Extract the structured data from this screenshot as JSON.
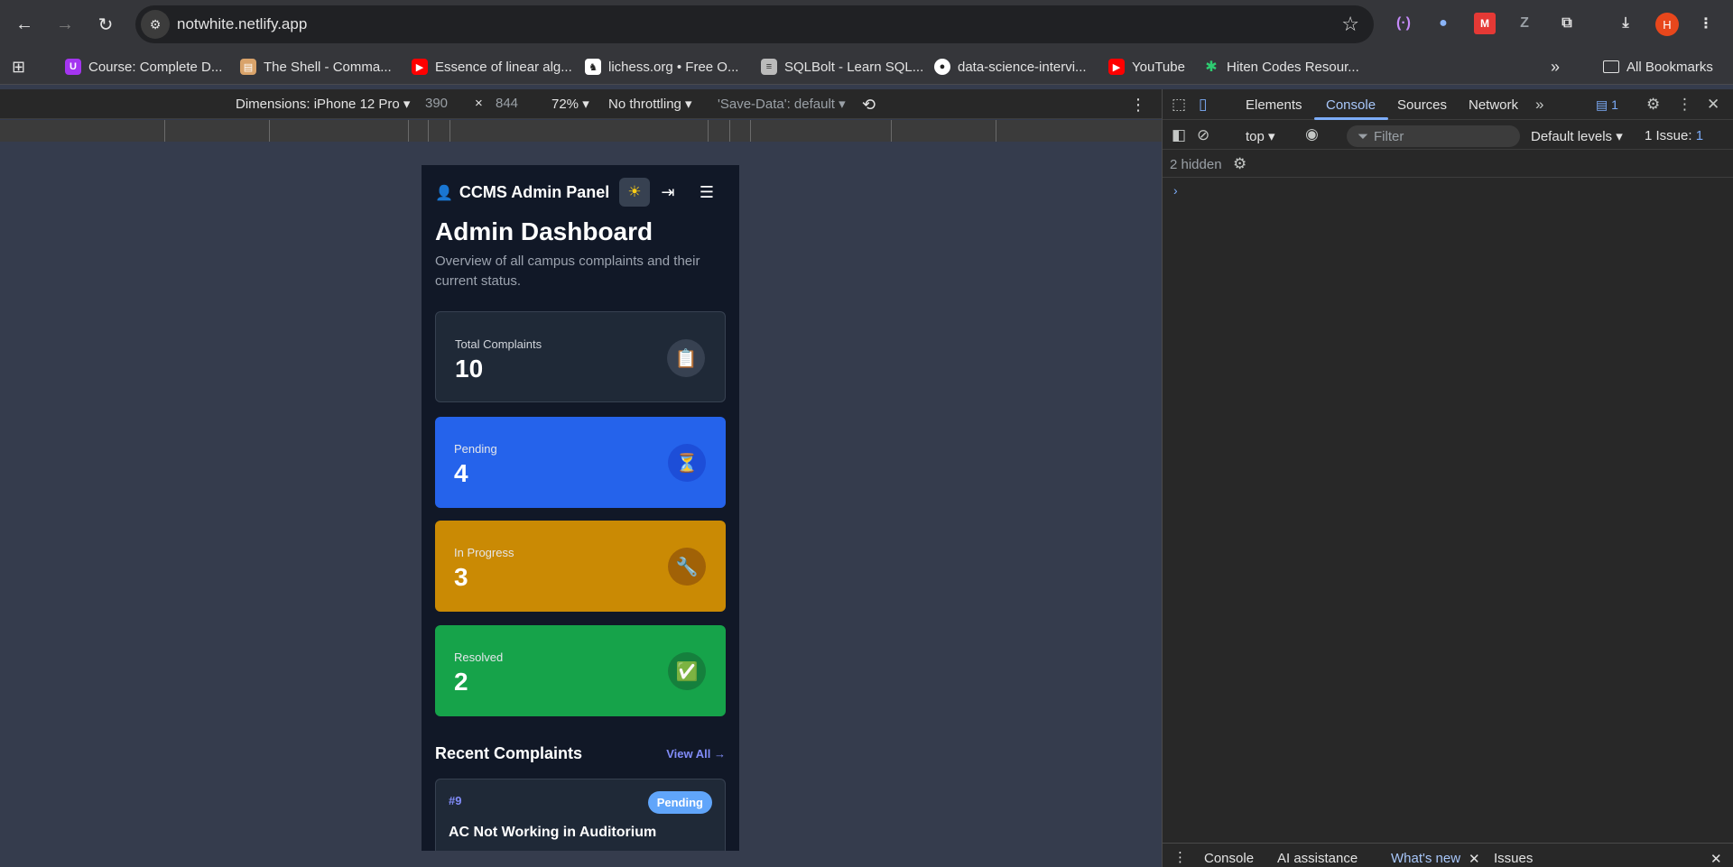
{
  "browser": {
    "url": "notwhite.netlify.app",
    "profile_initial": "H"
  },
  "bookmarks": [
    {
      "label": "Course: Complete D...",
      "icon": "udemy-icon",
      "color": "#a435f0"
    },
    {
      "label": "The Shell - Comma...",
      "icon": "shell-icon",
      "color": "#d9a36a"
    },
    {
      "label": "Essence of linear alg...",
      "icon": "youtube-icon",
      "color": "#ff0000"
    },
    {
      "label": "lichess.org • Free O...",
      "icon": "lichess-icon",
      "color": "#ffffff"
    },
    {
      "label": "SQLBolt - Learn SQL...",
      "icon": "database-icon",
      "color": "#bbbbbb"
    },
    {
      "label": "data-science-intervi...",
      "icon": "github-icon",
      "color": "#ffffff"
    },
    {
      "label": "YouTube",
      "icon": "youtube-icon",
      "color": "#ff0000"
    },
    {
      "label": "Hiten Codes Resour...",
      "icon": "asterisk-icon",
      "color": "#2ecc71"
    }
  ],
  "all_bookmarks": "All Bookmarks",
  "device_toolbar": {
    "dimensions": "Dimensions: iPhone 12 Pro",
    "width": "390",
    "times": "×",
    "height": "844",
    "zoom": "72%",
    "throttling": "No throttling",
    "save_data": "'Save-Data': default"
  },
  "app": {
    "brand": "CCMS Admin Panel",
    "title": "Admin Dashboard",
    "subtitle": "Overview of all campus complaints and their current status.",
    "stats": {
      "total": {
        "label": "Total Complaints",
        "value": "10",
        "icon": "📋"
      },
      "pending": {
        "label": "Pending",
        "value": "4",
        "icon": "⏳"
      },
      "in_progress": {
        "label": "In Progress",
        "value": "3",
        "icon": "🔧"
      },
      "resolved": {
        "label": "Resolved",
        "value": "2",
        "icon": "✅"
      }
    },
    "recent": {
      "title": "Recent Complaints",
      "view_all": "View All →",
      "items": [
        {
          "id": "#9",
          "status": "Pending",
          "title": "AC Not Working in Auditorium"
        }
      ]
    }
  },
  "devtools": {
    "tabs": [
      "Elements",
      "Console",
      "Sources",
      "Network"
    ],
    "active_tab": "Console",
    "messages_badge": "1",
    "context": "top",
    "filter_placeholder": "Filter",
    "levels": "Default levels",
    "issues": "1 Issue:",
    "issues_count": "1",
    "hidden": "2 hidden",
    "prompt": "›",
    "drawer_tabs": [
      "Console",
      "AI assistance",
      "What's new",
      "Issues"
    ]
  }
}
